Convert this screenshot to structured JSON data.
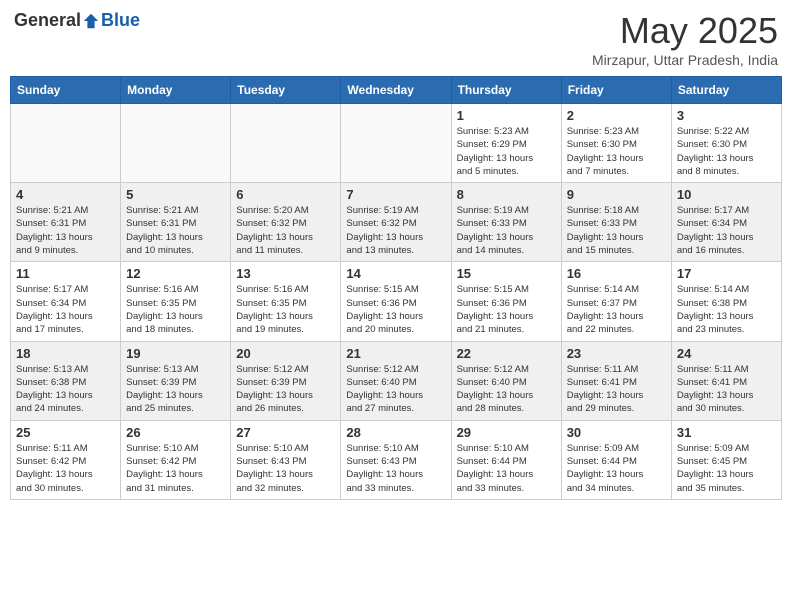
{
  "header": {
    "logo_general": "General",
    "logo_blue": "Blue",
    "month": "May 2025",
    "location": "Mirzapur, Uttar Pradesh, India"
  },
  "days_of_week": [
    "Sunday",
    "Monday",
    "Tuesday",
    "Wednesday",
    "Thursday",
    "Friday",
    "Saturday"
  ],
  "weeks": [
    [
      {
        "day": "",
        "info": ""
      },
      {
        "day": "",
        "info": ""
      },
      {
        "day": "",
        "info": ""
      },
      {
        "day": "",
        "info": ""
      },
      {
        "day": "1",
        "info": "Sunrise: 5:23 AM\nSunset: 6:29 PM\nDaylight: 13 hours\nand 5 minutes."
      },
      {
        "day": "2",
        "info": "Sunrise: 5:23 AM\nSunset: 6:30 PM\nDaylight: 13 hours\nand 7 minutes."
      },
      {
        "day": "3",
        "info": "Sunrise: 5:22 AM\nSunset: 6:30 PM\nDaylight: 13 hours\nand 8 minutes."
      }
    ],
    [
      {
        "day": "4",
        "info": "Sunrise: 5:21 AM\nSunset: 6:31 PM\nDaylight: 13 hours\nand 9 minutes."
      },
      {
        "day": "5",
        "info": "Sunrise: 5:21 AM\nSunset: 6:31 PM\nDaylight: 13 hours\nand 10 minutes."
      },
      {
        "day": "6",
        "info": "Sunrise: 5:20 AM\nSunset: 6:32 PM\nDaylight: 13 hours\nand 11 minutes."
      },
      {
        "day": "7",
        "info": "Sunrise: 5:19 AM\nSunset: 6:32 PM\nDaylight: 13 hours\nand 13 minutes."
      },
      {
        "day": "8",
        "info": "Sunrise: 5:19 AM\nSunset: 6:33 PM\nDaylight: 13 hours\nand 14 minutes."
      },
      {
        "day": "9",
        "info": "Sunrise: 5:18 AM\nSunset: 6:33 PM\nDaylight: 13 hours\nand 15 minutes."
      },
      {
        "day": "10",
        "info": "Sunrise: 5:17 AM\nSunset: 6:34 PM\nDaylight: 13 hours\nand 16 minutes."
      }
    ],
    [
      {
        "day": "11",
        "info": "Sunrise: 5:17 AM\nSunset: 6:34 PM\nDaylight: 13 hours\nand 17 minutes."
      },
      {
        "day": "12",
        "info": "Sunrise: 5:16 AM\nSunset: 6:35 PM\nDaylight: 13 hours\nand 18 minutes."
      },
      {
        "day": "13",
        "info": "Sunrise: 5:16 AM\nSunset: 6:35 PM\nDaylight: 13 hours\nand 19 minutes."
      },
      {
        "day": "14",
        "info": "Sunrise: 5:15 AM\nSunset: 6:36 PM\nDaylight: 13 hours\nand 20 minutes."
      },
      {
        "day": "15",
        "info": "Sunrise: 5:15 AM\nSunset: 6:36 PM\nDaylight: 13 hours\nand 21 minutes."
      },
      {
        "day": "16",
        "info": "Sunrise: 5:14 AM\nSunset: 6:37 PM\nDaylight: 13 hours\nand 22 minutes."
      },
      {
        "day": "17",
        "info": "Sunrise: 5:14 AM\nSunset: 6:38 PM\nDaylight: 13 hours\nand 23 minutes."
      }
    ],
    [
      {
        "day": "18",
        "info": "Sunrise: 5:13 AM\nSunset: 6:38 PM\nDaylight: 13 hours\nand 24 minutes."
      },
      {
        "day": "19",
        "info": "Sunrise: 5:13 AM\nSunset: 6:39 PM\nDaylight: 13 hours\nand 25 minutes."
      },
      {
        "day": "20",
        "info": "Sunrise: 5:12 AM\nSunset: 6:39 PM\nDaylight: 13 hours\nand 26 minutes."
      },
      {
        "day": "21",
        "info": "Sunrise: 5:12 AM\nSunset: 6:40 PM\nDaylight: 13 hours\nand 27 minutes."
      },
      {
        "day": "22",
        "info": "Sunrise: 5:12 AM\nSunset: 6:40 PM\nDaylight: 13 hours\nand 28 minutes."
      },
      {
        "day": "23",
        "info": "Sunrise: 5:11 AM\nSunset: 6:41 PM\nDaylight: 13 hours\nand 29 minutes."
      },
      {
        "day": "24",
        "info": "Sunrise: 5:11 AM\nSunset: 6:41 PM\nDaylight: 13 hours\nand 30 minutes."
      }
    ],
    [
      {
        "day": "25",
        "info": "Sunrise: 5:11 AM\nSunset: 6:42 PM\nDaylight: 13 hours\nand 30 minutes."
      },
      {
        "day": "26",
        "info": "Sunrise: 5:10 AM\nSunset: 6:42 PM\nDaylight: 13 hours\nand 31 minutes."
      },
      {
        "day": "27",
        "info": "Sunrise: 5:10 AM\nSunset: 6:43 PM\nDaylight: 13 hours\nand 32 minutes."
      },
      {
        "day": "28",
        "info": "Sunrise: 5:10 AM\nSunset: 6:43 PM\nDaylight: 13 hours\nand 33 minutes."
      },
      {
        "day": "29",
        "info": "Sunrise: 5:10 AM\nSunset: 6:44 PM\nDaylight: 13 hours\nand 33 minutes."
      },
      {
        "day": "30",
        "info": "Sunrise: 5:09 AM\nSunset: 6:44 PM\nDaylight: 13 hours\nand 34 minutes."
      },
      {
        "day": "31",
        "info": "Sunrise: 5:09 AM\nSunset: 6:45 PM\nDaylight: 13 hours\nand 35 minutes."
      }
    ]
  ]
}
